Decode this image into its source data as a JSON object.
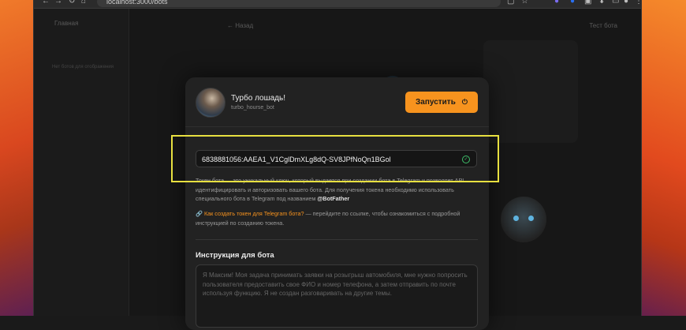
{
  "browser": {
    "url": "localhost:3000/bots",
    "nav_icons": [
      "←",
      "→",
      "↻",
      "⌂"
    ],
    "right_icons": [
      "▢",
      "☆",
      "●",
      "●",
      "▣",
      "⬇",
      "▭",
      "●",
      "⋮"
    ]
  },
  "background": {
    "sidebar_title": "Главная",
    "sidebar_empty": "Нет ботов для отображения",
    "main_head": "← Назад",
    "main_right": "Тест бота"
  },
  "modal": {
    "bot_name": "Турбо лошадь!",
    "bot_username": "turbo_hourse_bot",
    "run_button": "Запустить",
    "token_value": "6838881056:AAEA1_V1CglDmXLg8dQ-SV8JPfNoQn1BGol",
    "token_info": "Токен бота — это уникальный ключ, который выдается при создании бота в Telegram и позволяет API идентифицировать и авторизовать вашего бота. Для получения токена необходимо использовать специального бота в Telegram под названием",
    "botfather": "@BotFather",
    "help_link": "Как создать токен для Telegram бота?",
    "help_text": "— перейдите по ссылке, чтобы ознакомиться с подробной инструкцией по созданию токена.",
    "instruction_label": "Инструкция для бота",
    "instruction_text": "Я Максим! Моя задача принимать заявки на розыгрыш автомобиля, мне нужно попросить пользователя предоставить свое ФИО и номер телефона, а затем отправить по почте используя функцию. Я не создан разговаривать на другие темы."
  },
  "colors": {
    "accent": "#f7931e",
    "highlight": "#e8e040",
    "success": "#3fbf6a"
  }
}
